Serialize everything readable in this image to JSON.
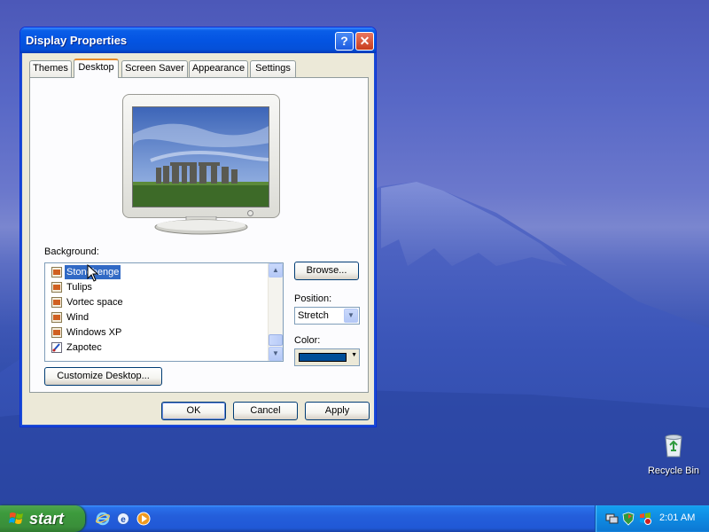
{
  "window": {
    "title": "Display Properties",
    "help_icon": "help-icon",
    "close_icon": "close-icon"
  },
  "tabs": [
    {
      "label": "Themes"
    },
    {
      "label": "Desktop",
      "active": true
    },
    {
      "label": "Screen Saver"
    },
    {
      "label": "Appearance"
    },
    {
      "label": "Settings"
    }
  ],
  "desktop_tab": {
    "background_label": "Background:",
    "background_items": [
      {
        "label": "Stonehenge",
        "icon": "image-file-icon",
        "selected": true
      },
      {
        "label": "Tulips",
        "icon": "image-file-icon"
      },
      {
        "label": "Vortec space",
        "icon": "image-file-icon"
      },
      {
        "label": "Wind",
        "icon": "image-file-icon"
      },
      {
        "label": "Windows XP",
        "icon": "image-file-icon"
      },
      {
        "label": "Zapotec",
        "icon": "paint-file-icon"
      }
    ],
    "browse_label": "Browse...",
    "position_label": "Position:",
    "position_value": "Stretch",
    "color_label": "Color:",
    "color_value": "#004e98",
    "customize_label": "Customize Desktop..."
  },
  "buttons": {
    "ok": "OK",
    "cancel": "Cancel",
    "apply": "Apply"
  },
  "desktop": {
    "recycle_bin_label": "Recycle Bin"
  },
  "taskbar": {
    "start_label": "start",
    "quick_launch": [
      "internet-explorer-icon",
      "outlook-express-icon",
      "media-player-icon"
    ],
    "tray_icons": [
      "network-icon",
      "security-shield-icon",
      "updates-icon"
    ],
    "clock": "2:01 AM"
  },
  "colors": {
    "titlebar": "#0454e2",
    "selection": "#316ac5",
    "taskbar": "#245edb",
    "start_button": "#3c9a3c"
  }
}
